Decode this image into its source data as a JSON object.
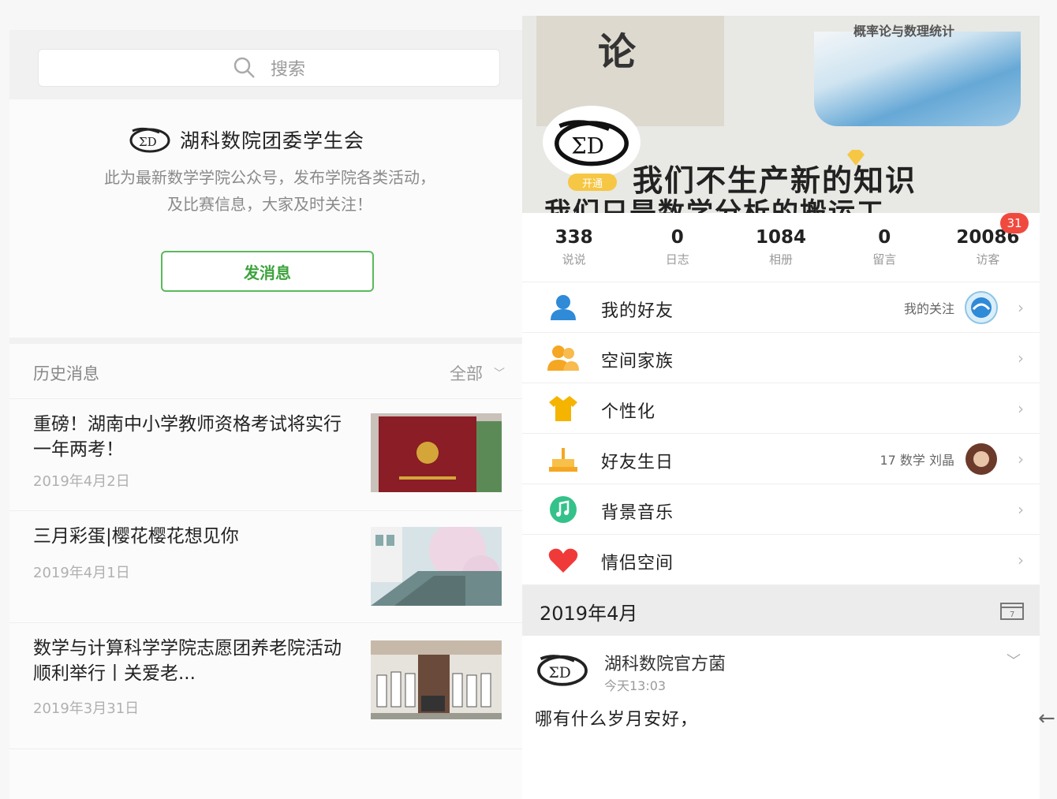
{
  "left": {
    "search_placeholder": "搜索",
    "account_name": "湖科数院团委学生会",
    "description_line1": "此为最新数学学院公众号，发布学院各类活动，",
    "description_line2": "及比赛信息，大家及时关注！",
    "message_button": "发消息",
    "history_title": "历史消息",
    "filter_label": "全部",
    "articles": [
      {
        "title": "重磅！湖南中小学教师资格考试将实行一年两考！",
        "date": "2019年4月2日"
      },
      {
        "title": "三月彩蛋|樱花樱花想见你",
        "date": "2019年4月1日"
      },
      {
        "title": "数学与计算科学学院志愿团养老院活动顺利举行丨关爱老...",
        "date": "2019年3月31日"
      }
    ]
  },
  "right": {
    "cover": {
      "book1_char": "论",
      "book2_title": "概率论与数理统计",
      "motto1": "我们不生产新的知识",
      "motto2": "我们只是数学分析的搬运工",
      "vip_label": "开通"
    },
    "stats": [
      {
        "value": "338",
        "label": "说说"
      },
      {
        "value": "0",
        "label": "日志"
      },
      {
        "value": "1084",
        "label": "相册"
      },
      {
        "value": "0",
        "label": "留言"
      },
      {
        "value": "20086",
        "label": "访客"
      }
    ],
    "visitor_badge": "31",
    "menu": [
      {
        "label": "我的好友",
        "extra": "我的关注",
        "icon": "friend-icon"
      },
      {
        "label": "空间家族",
        "extra": "",
        "icon": "family-icon"
      },
      {
        "label": "个性化",
        "extra": "",
        "icon": "shirt-icon"
      },
      {
        "label": "好友生日",
        "extra": "17 数学 刘晶",
        "icon": "cake-icon"
      },
      {
        "label": "背景音乐",
        "extra": "",
        "icon": "music-icon"
      },
      {
        "label": "情侣空间",
        "extra": "",
        "icon": "heart-icon"
      }
    ],
    "month": "2019年4月",
    "post": {
      "author": "湖科数院官方菌",
      "time": "今天13:03",
      "text": "哪有什么岁月安好，"
    }
  },
  "colors": {
    "accent_green": "#3da33d",
    "badge_red": "#f04a3f",
    "icon_blue": "#2f8ad8",
    "icon_orange": "#f5a623",
    "icon_green": "#34c28a",
    "icon_red": "#f03a3a"
  }
}
